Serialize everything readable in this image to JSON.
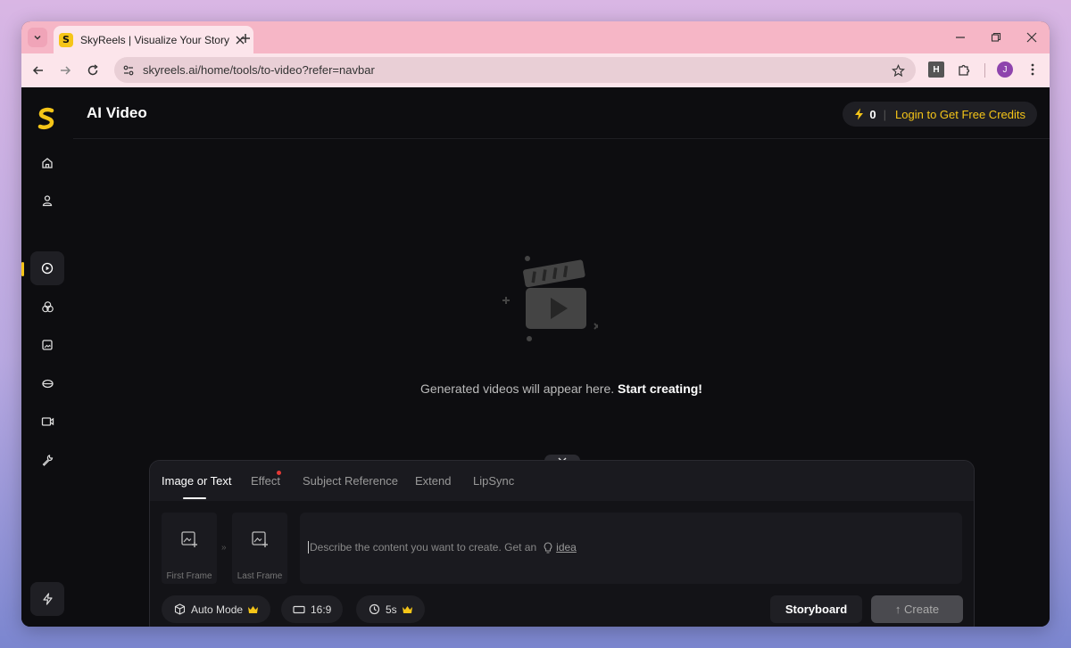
{
  "browser": {
    "tab_title": "SkyReels | Visualize Your Story",
    "url": "skyreels.ai/home/tools/to-video?refer=navbar",
    "extension_label": "H",
    "profile_initial": "J"
  },
  "header": {
    "title": "AI Video",
    "credits_count": "0",
    "credits_separator": "|",
    "login_label": "Login to Get Free Credits"
  },
  "empty_state": {
    "message": "Generated videos will appear here.",
    "cta": "Start creating!"
  },
  "panel": {
    "tabs": [
      {
        "label": "Image or Text"
      },
      {
        "label": "Effect"
      },
      {
        "label": "Subject Reference"
      },
      {
        "label": "Extend"
      },
      {
        "label": "LipSync"
      }
    ],
    "first_frame_label": "First Frame",
    "last_frame_label": "Last Frame",
    "frame_arrow": "»",
    "prompt_placeholder": "Describe the content you want to create. Get an",
    "idea_label": "idea",
    "mode_label": "Auto Mode",
    "ratio_label": "16:9",
    "duration_label": "5s",
    "storyboard_label": "Storyboard",
    "create_label": "↑ Create"
  },
  "colors": {
    "accent": "#f5c518",
    "background": "#0d0d10",
    "tab_strip": "#f6b6c6"
  }
}
